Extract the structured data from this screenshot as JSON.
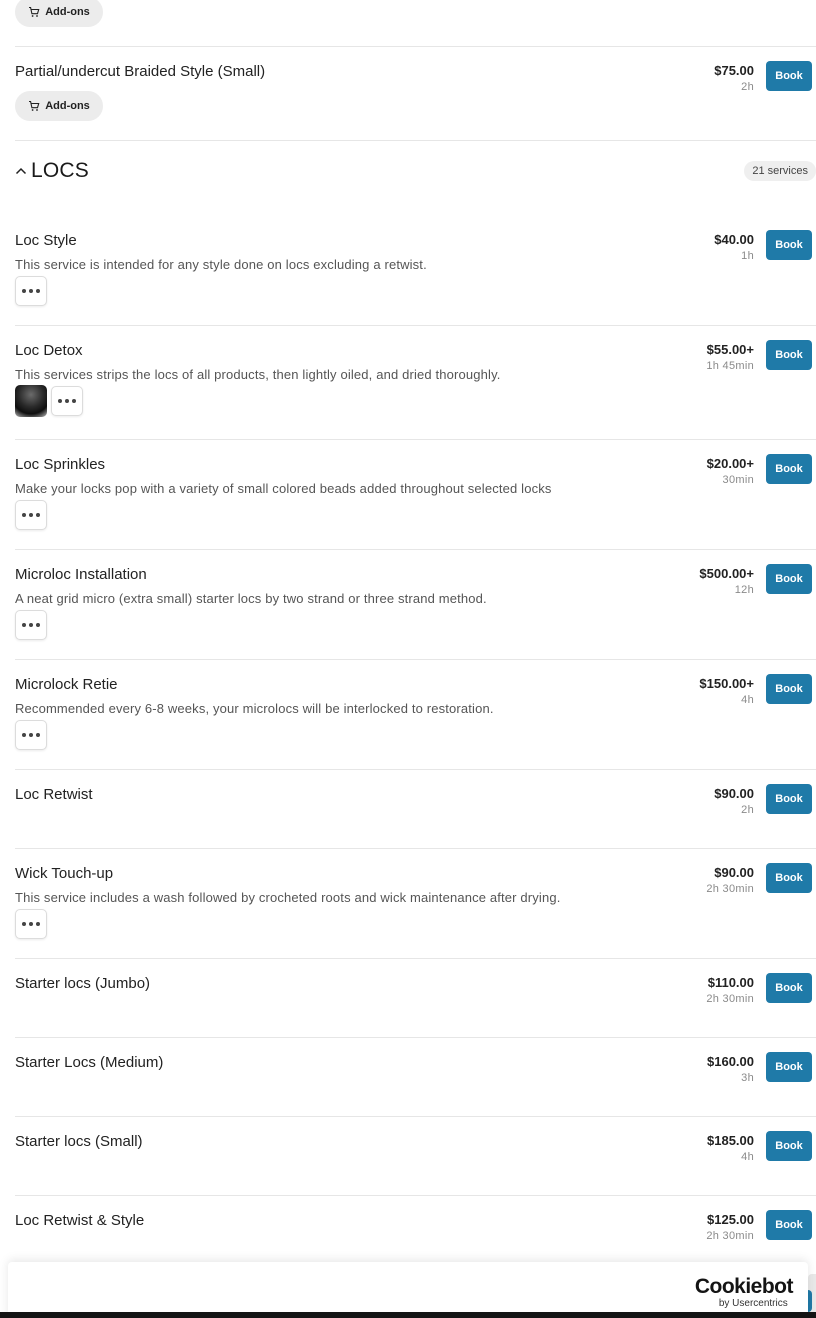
{
  "top_addons": {
    "label": "Add-ons"
  },
  "prev_service": {
    "name": "Partial/undercut Braided Style (Small)",
    "price": "$75.00",
    "duration": "2h",
    "book_label": "Book",
    "addons_label": "Add-ons"
  },
  "section": {
    "title": "LOCS",
    "count": "21 services"
  },
  "services": [
    {
      "name": "Loc Style",
      "description": "This service is intended for any style done on locs excluding a retwist.",
      "price": "$40.00",
      "duration": "1h",
      "book_label": "Book"
    },
    {
      "name": "Loc Detox",
      "description": "This services strips the locs of all products, then lightly oiled, and dried thoroughly.",
      "price": "$55.00+",
      "duration": "1h 45min",
      "book_label": "Book"
    },
    {
      "name": "Loc Sprinkles",
      "description": "Make your locks pop with a variety of small colored beads added throughout selected locks",
      "price": "$20.00+",
      "duration": "30min",
      "book_label": "Book"
    },
    {
      "name": "Microloc Installation",
      "description": "A neat grid micro (extra small) starter locs by two strand or three strand method.",
      "price": "$500.00+",
      "duration": "12h",
      "book_label": "Book"
    },
    {
      "name": "Microlock Retie",
      "description": "Recommended every 6-8 weeks, your microlocs will be interlocked to restoration.",
      "price": "$150.00+",
      "duration": "4h",
      "book_label": "Book"
    },
    {
      "name": "Loc Retwist",
      "description": "",
      "price": "$90.00",
      "duration": "2h",
      "book_label": "Book"
    },
    {
      "name": "Wick Touch-up",
      "description": "This service includes a wash followed by crocheted roots and wick maintenance after drying.",
      "price": "$90.00",
      "duration": "2h 30min",
      "book_label": "Book"
    },
    {
      "name": "Starter locs (Jumbo)",
      "description": "",
      "price": "$110.00",
      "duration": "2h 30min",
      "book_label": "Book"
    },
    {
      "name": "Starter Locs (Medium)",
      "description": "",
      "price": "$160.00",
      "duration": "3h",
      "book_label": "Book"
    },
    {
      "name": "Starter locs (Small)",
      "description": "",
      "price": "$185.00",
      "duration": "4h",
      "book_label": "Book"
    },
    {
      "name": "Loc Retwist & Style",
      "description": "",
      "price": "$125.00",
      "duration": "2h 30min",
      "book_label": "Book"
    }
  ],
  "cookie_banner": {
    "brand": "Cookiebot",
    "sub": "by Usercentrics"
  },
  "colors": {
    "book_button": "#1f7aa8",
    "addons_bg": "#ececec"
  }
}
